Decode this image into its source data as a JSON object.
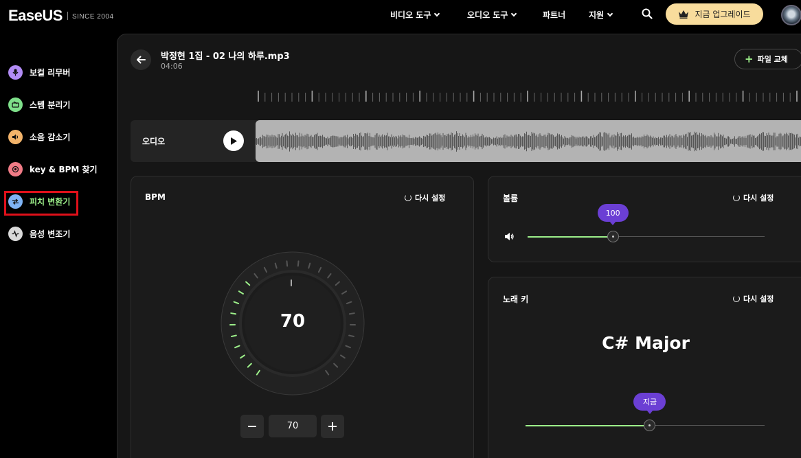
{
  "brand": {
    "logo": "EaseUS",
    "since": "SINCE 2004"
  },
  "nav": {
    "video_tools": "비디오 도구",
    "audio_tools": "오디오 도구",
    "partner": "파트너",
    "support": "지원",
    "upgrade": "지금 업그레이드"
  },
  "sidebar": {
    "items": [
      {
        "label": "보컬 리무버",
        "color": "#b28cf5"
      },
      {
        "label": "스템 분리기",
        "color": "#7ee08a"
      },
      {
        "label": "소음 감소기",
        "color": "#f2b36a"
      },
      {
        "label": "key & BPM 찾기",
        "color": "#f07b86"
      },
      {
        "label": "피치 변환기",
        "color": "#7fb3f5",
        "active": true
      },
      {
        "label": "음성 변조기",
        "color": "#d9d9d9"
      }
    ]
  },
  "file": {
    "name": "박정현 1집 - 02 나의 하루.mp3",
    "duration": "04:06",
    "replace": "파일 교체"
  },
  "track": {
    "label": "오디오"
  },
  "bpm": {
    "title": "BPM",
    "reset": "다시 설정",
    "value": "70",
    "stepper_value": "70",
    "dial_fraction": 0.35
  },
  "volume": {
    "title": "볼륨",
    "reset": "다시 설정",
    "value": "100",
    "level": 0.36
  },
  "key": {
    "title": "노래 키",
    "reset": "다시 설정",
    "name": "C# Major",
    "bubble": "지금",
    "level": 0.52
  },
  "colors": {
    "accent": "#9df08a",
    "bubble": "#6b3fd4",
    "upgrade": "#f8dc9c",
    "highlight": "#e0101a"
  }
}
